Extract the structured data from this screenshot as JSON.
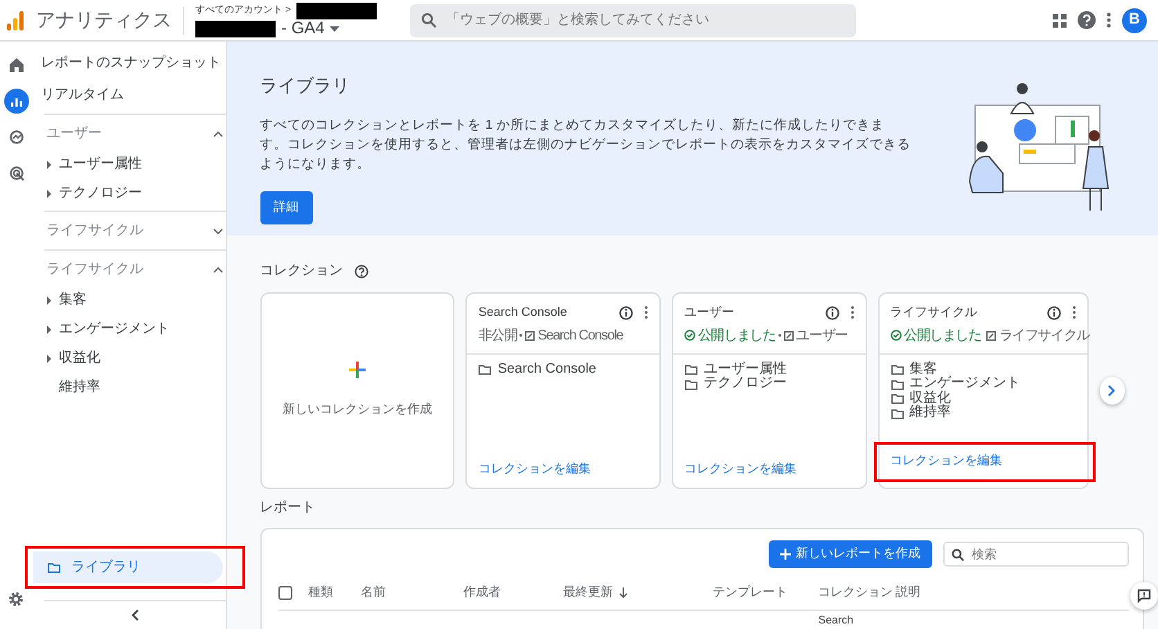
{
  "app": {
    "name": "アナリティクス"
  },
  "account": {
    "breadcrumb": "すべてのアカウント >",
    "property": "- GA4",
    "redacted": true
  },
  "search": {
    "placeholder": "「ウェブの概要」と検索してみてください"
  },
  "avatar": "B",
  "rail": [
    {
      "kind": "home",
      "selected": false
    },
    {
      "kind": "reports",
      "selected": true
    },
    {
      "kind": "explore",
      "selected": false
    },
    {
      "kind": "advertising",
      "selected": false
    }
  ],
  "sidebar": {
    "items": [
      {
        "kind": "link",
        "label": "レポートのスナップショット"
      },
      {
        "kind": "link",
        "label": "リアルタイム"
      },
      {
        "kind": "section",
        "label": "ユーザー",
        "expanded": true,
        "children": [
          {
            "label": "ユーザー属性",
            "has_children": true
          },
          {
            "label": "テクノロジー",
            "has_children": true
          }
        ]
      },
      {
        "kind": "section",
        "label": "ライフサイクル",
        "expanded": false
      },
      {
        "kind": "section",
        "label": "ライフサイクル",
        "expanded": true,
        "children": [
          {
            "label": "集客",
            "has_children": true
          },
          {
            "label": "エンゲージメント",
            "has_children": true
          },
          {
            "label": "収益化",
            "has_children": true
          },
          {
            "label": "維持率",
            "has_children": false
          }
        ]
      }
    ],
    "library": {
      "label": "ライブラリ",
      "selected": true,
      "highlighted": true
    }
  },
  "banner": {
    "title": "ライブラリ",
    "text": "すべてのコレクションとレポートを 1 か所にまとめてカスタマイズしたり、新たに作成したりできます。コレクションを使用すると、管理者は左側のナビゲーションでレポートの表示をカスタマイズできるようになります。",
    "button": "詳細"
  },
  "collections": {
    "title": "コレクション",
    "create_label": "新しいコレクションを作成",
    "cards": [
      {
        "title": "Search Console",
        "published": false,
        "status": "非公開",
        "source": "Search Console",
        "items": [
          "Search Console"
        ],
        "edit_link": "コレクションを編集",
        "highlighted": false
      },
      {
        "title": "ユーザー",
        "published": true,
        "status": "公開しました",
        "source": "ユーザー",
        "items": [
          "ユーザー属性",
          "テクノロジー"
        ],
        "edit_link": "コレクションを編集",
        "highlighted": false
      },
      {
        "title": "ライフサイクル",
        "published": true,
        "status": "公開しました",
        "source": "ライフサイクル",
        "items": [
          "集客",
          "エンゲージメント",
          "収益化",
          "維持率"
        ],
        "edit_link": "コレクションを編集",
        "highlighted": true
      }
    ]
  },
  "reports": {
    "title": "レポート",
    "new_button": "新しいレポートを作成",
    "search_placeholder": "検索",
    "select_all": {
      "checked": false
    },
    "columns": [
      {
        "label": "種類",
        "sorted": false
      },
      {
        "label": "名前",
        "sorted": false
      },
      {
        "label": "作成者",
        "sorted": false
      },
      {
        "label": "最終更新",
        "sorted": true
      },
      {
        "label": "テンプレート",
        "sorted": false
      },
      {
        "label": "コレクション",
        "sorted": false
      },
      {
        "label": "説明",
        "sorted": false
      }
    ],
    "partial_row": {
      "collection": "Search"
    }
  }
}
